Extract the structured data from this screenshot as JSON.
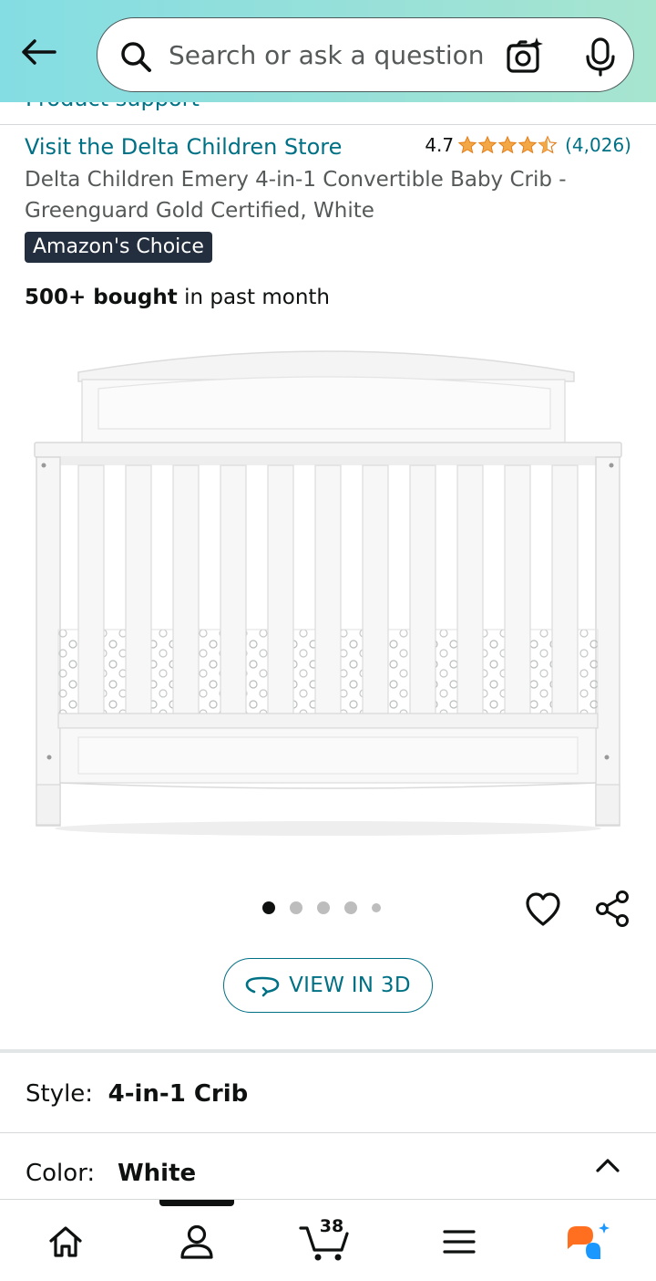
{
  "header": {
    "search_placeholder": "Search or ask a question",
    "gradient_start": "#84dde3",
    "gradient_end": "#a7e5cf",
    "peek_text": "Product support"
  },
  "product": {
    "store_link": "Visit the Delta Children Store",
    "rating": "4.7",
    "rating_stars_value": 4.7,
    "review_count": "(4,026)",
    "title": "Delta Children Emery 4-in-1 Convertible Baby Crib - Greenguard Gold Certified, White",
    "badge": "Amazon's Choice",
    "bought_bold": "500+ bought",
    "bought_rest": " in past month",
    "image_icon": "baby-crib-image",
    "image_count": 5,
    "image_index": 1
  },
  "actions": {
    "view_3d_label": "VIEW IN 3D",
    "favorite_icon": "heart-icon",
    "share_icon": "share-icon"
  },
  "variations": {
    "style_label": "Style:",
    "style_value": "4-in-1 Crib",
    "color_label": "Color:",
    "color_value": "White"
  },
  "bottom_nav": {
    "cart_count": "38",
    "items": [
      "home-icon",
      "account-icon",
      "cart-icon",
      "menu-icon",
      "rufus-icon"
    ]
  },
  "colors": {
    "link": "#007185",
    "star": "#f3a847",
    "badge_bg": "#232f3e",
    "rufus_orange": "#ff6f1f",
    "rufus_blue": "#1a98ff"
  }
}
